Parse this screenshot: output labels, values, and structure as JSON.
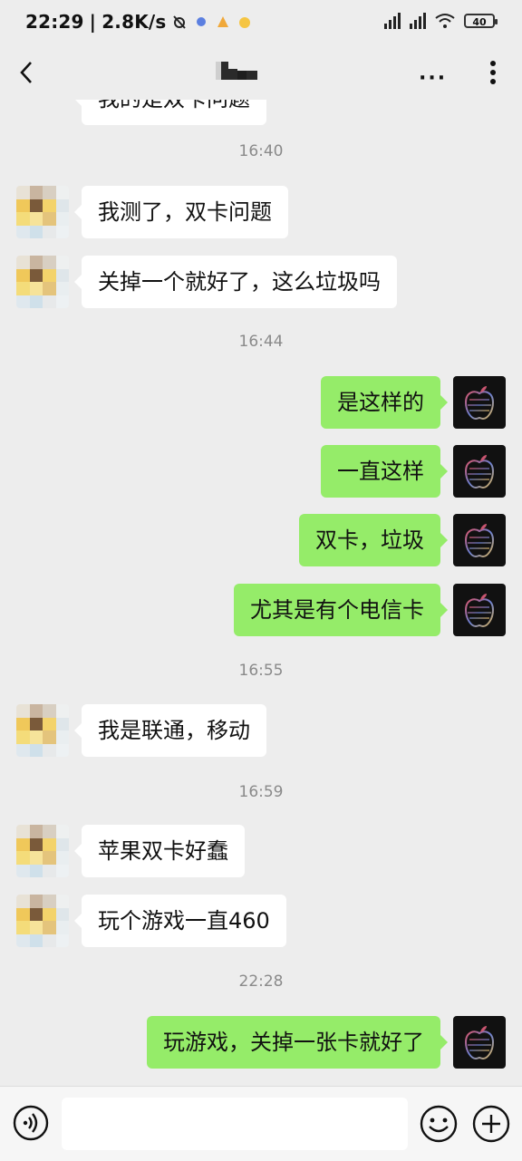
{
  "status_bar": {
    "time": "22:29",
    "net_speed": "2.8K/s",
    "battery": "40"
  },
  "header": {
    "more_label": "···"
  },
  "chat": {
    "top_partial_text": "我的是双卡问题",
    "messages": [
      {
        "kind": "time",
        "text": "16:40"
      },
      {
        "kind": "in",
        "text": "我测了，双卡问题"
      },
      {
        "kind": "in",
        "text": "关掉一个就好了，这么垃圾吗"
      },
      {
        "kind": "time",
        "text": "16:44"
      },
      {
        "kind": "out",
        "text": "是这样的"
      },
      {
        "kind": "out",
        "text": "一直这样"
      },
      {
        "kind": "out",
        "text": "双卡，垃圾"
      },
      {
        "kind": "out",
        "text": "尤其是有个电信卡"
      },
      {
        "kind": "time",
        "text": "16:55"
      },
      {
        "kind": "in",
        "text": "我是联通，移动"
      },
      {
        "kind": "time",
        "text": "16:59"
      },
      {
        "kind": "in",
        "text": "苹果双卡好蠢"
      },
      {
        "kind": "in",
        "text": "玩个游戏一直460"
      },
      {
        "kind": "time",
        "text": "22:28"
      },
      {
        "kind": "out",
        "text": "玩游戏，关掉一张卡就好了"
      }
    ]
  },
  "input": {
    "placeholder": ""
  },
  "colors": {
    "background": "#ededed",
    "bubble_out": "#95ec69",
    "bubble_in": "#ffffff",
    "timestamp": "#8a8a8a"
  },
  "icons": [
    "back-icon",
    "more-icon",
    "kebab-icon",
    "voice-icon",
    "emoji-icon",
    "plus-icon"
  ]
}
